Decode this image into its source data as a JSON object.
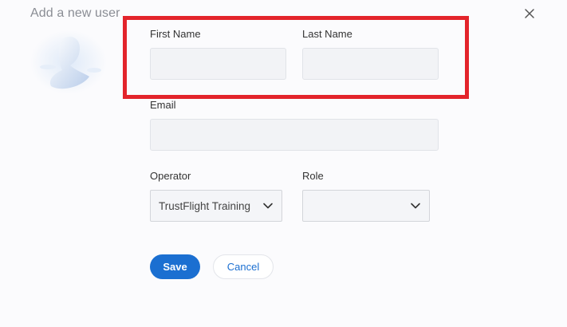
{
  "modal": {
    "title": "Add a new user"
  },
  "form": {
    "first_name": {
      "label": "First Name",
      "value": "",
      "placeholder": ""
    },
    "last_name": {
      "label": "Last Name",
      "value": "",
      "placeholder": ""
    },
    "email": {
      "label": "Email",
      "value": "",
      "placeholder": ""
    },
    "operator": {
      "label": "Operator",
      "selected": "TrustFlight Training"
    },
    "role": {
      "label": "Role",
      "selected": ""
    }
  },
  "actions": {
    "save_label": "Save",
    "cancel_label": "Cancel"
  },
  "icons": {
    "close": "close-icon",
    "avatar": "user-avatar-icon",
    "chevron": "chevron-down-icon"
  },
  "colors": {
    "primary": "#1b6fd1",
    "highlight": "#e3242b",
    "input_bg": "#f2f3f6"
  }
}
